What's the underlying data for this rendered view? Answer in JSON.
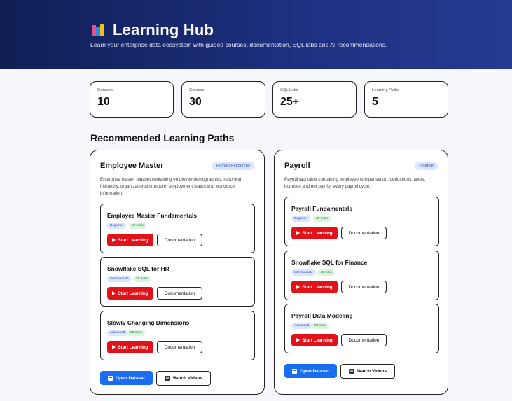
{
  "hero": {
    "title": "Learning Hub",
    "subtitle": "Learn your enterprise data ecosystem with guided courses, documentation, SQL labs and AI recommendations.",
    "icon": "books-icon"
  },
  "stats": [
    {
      "label": "Datasets",
      "value": "10"
    },
    {
      "label": "Courses",
      "value": "30"
    },
    {
      "label": "SQL Labs",
      "value": "25+"
    },
    {
      "label": "Learning Paths",
      "value": "5"
    }
  ],
  "section_title": "Recommended Learning Paths",
  "paths": [
    {
      "title": "Employee Master",
      "tag": "Human Resources",
      "description": "Enterprise master dataset containing employee demographics, reporting hierarchy, organizational structure, employment status and workforce information.",
      "courses": [
        {
          "title": "Employee Master Fundamentals",
          "level": "Beginner",
          "duration": "20 mins"
        },
        {
          "title": "Snowflake SQL for HR",
          "level": "Intermediate",
          "duration": "35 mins"
        },
        {
          "title": "Slowly Changing Dimensions",
          "level": "Advanced",
          "duration": "30 mins"
        }
      ]
    },
    {
      "title": "Payroll",
      "tag": "Finance",
      "description": "Payroll fact table containing employee compensation, deductions, taxes, bonuses and net pay for every payroll cycle.",
      "courses": [
        {
          "title": "Payroll Fundamentals",
          "level": "Beginner",
          "duration": "25 mins"
        },
        {
          "title": "Snowflake SQL for Finance",
          "level": "Intermediate",
          "duration": "40 mins"
        },
        {
          "title": "Payroll Data Modeling",
          "level": "Advanced",
          "duration": "30 mins"
        }
      ]
    }
  ],
  "buttons": {
    "start": "Start Learning",
    "documentation": "Documentation",
    "open_dataset": "Open Dataset",
    "watch_videos": "Watch Videos"
  },
  "colors": {
    "hero_start": "#0f1f55",
    "hero_end": "#273a94",
    "start_button": "#e2121b",
    "primary_button": "#1a6cf0"
  }
}
